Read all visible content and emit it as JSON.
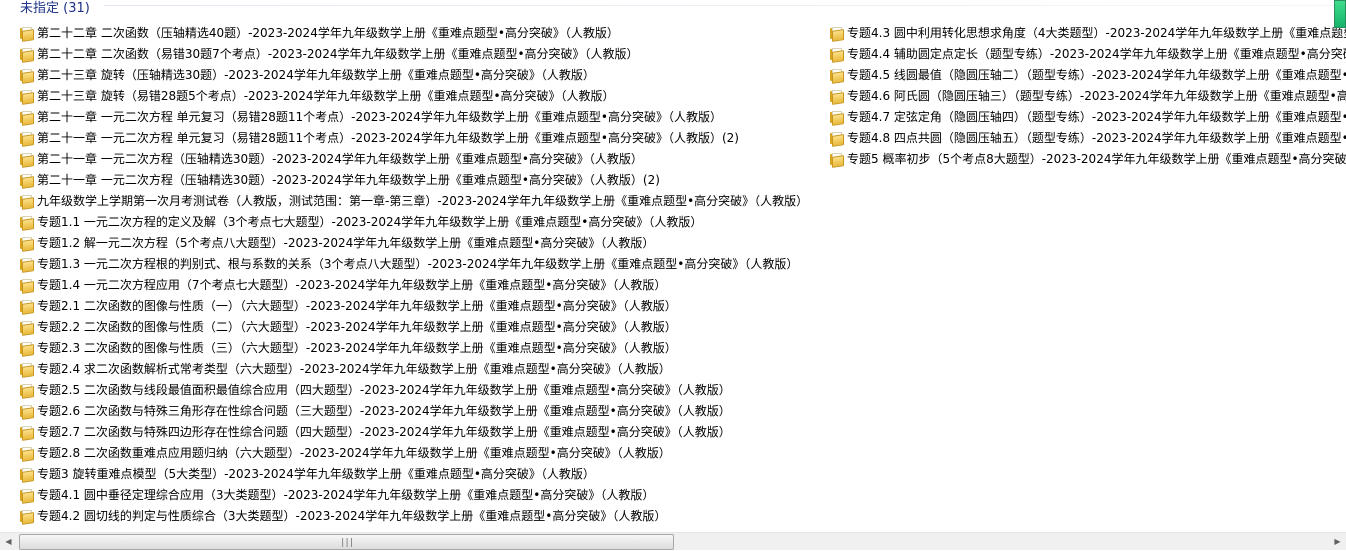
{
  "group": {
    "title": "未指定 (31)"
  },
  "left_items": [
    "第二十二章 二次函数（压轴精选40题）-2023-2024学年九年级数学上册《重难点题型•高分突破》（人教版）",
    "第二十二章 二次函数（易错30题7个考点）-2023-2024学年九年级数学上册《重难点题型•高分突破》（人教版）",
    "第二十三章 旋转（压轴精选30题）-2023-2024学年九年级数学上册《重难点题型•高分突破》（人教版）",
    "第二十三章 旋转（易错28题5个考点）-2023-2024学年九年级数学上册《重难点题型•高分突破》（人教版）",
    "第二十一章 一元二次方程 单元复习（易错28题11个考点）-2023-2024学年九年级数学上册《重难点题型•高分突破》（人教版）",
    "第二十一章 一元二次方程 单元复习（易错28题11个考点）-2023-2024学年九年级数学上册《重难点题型•高分突破》（人教版）(2)",
    "第二十一章 一元二次方程（压轴精选30题）-2023-2024学年九年级数学上册《重难点题型•高分突破》（人教版）",
    "第二十一章 一元二次方程（压轴精选30题）-2023-2024学年九年级数学上册《重难点题型•高分突破》（人教版）(2)",
    "九年级数学上学期第一次月考测试卷（人教版，测试范围：第一章-第三章）-2023-2024学年九年级数学上册《重难点题型•高分突破》（人教版）",
    "专题1.1 一元二次方程的定义及解（3个考点七大题型）-2023-2024学年九年级数学上册《重难点题型•高分突破》（人教版）",
    "专题1.2 解一元二次方程（5个考点八大题型）-2023-2024学年九年级数学上册《重难点题型•高分突破》（人教版）",
    "专题1.3 一元二次方程根的判别式、根与系数的关系（3个考点八大题型）-2023-2024学年九年级数学上册《重难点题型•高分突破》（人教版）",
    "专题1.4 一元二次方程应用（7个考点七大题型）-2023-2024学年九年级数学上册《重难点题型•高分突破》（人教版）",
    "专题2.1 二次函数的图像与性质（一）（六大题型）-2023-2024学年九年级数学上册《重难点题型•高分突破》（人教版）",
    "专题2.2 二次函数的图像与性质（二）（六大题型）-2023-2024学年九年级数学上册《重难点题型•高分突破》（人教版）",
    "专题2.3 二次函数的图像与性质（三）（六大题型）-2023-2024学年九年级数学上册《重难点题型•高分突破》（人教版）",
    "专题2.4 求二次函数解析式常考类型（六大题型）-2023-2024学年九年级数学上册《重难点题型•高分突破》（人教版）",
    "专题2.5 二次函数与线段最值面积最值综合应用（四大题型）-2023-2024学年九年级数学上册《重难点题型•高分突破》（人教版）",
    "专题2.6 二次函数与特殊三角形存在性综合问题（三大题型）-2023-2024学年九年级数学上册《重难点题型•高分突破》（人教版）",
    "专题2.7 二次函数与特殊四边形存在性综合问题（四大题型）-2023-2024学年九年级数学上册《重难点题型•高分突破》（人教版）",
    "专题2.8 二次函数重难点应用题归纳（六大题型）-2023-2024学年九年级数学上册《重难点题型•高分突破》（人教版）",
    "专题3 旋转重难点模型（5大类型）-2023-2024学年九年级数学上册《重难点题型•高分突破》（人教版）",
    "专题4.1 圆中垂径定理综合应用（3大类题型）-2023-2024学年九年级数学上册《重难点题型•高分突破》（人教版）",
    "专题4.2 圆切线的判定与性质综合（3大类题型）-2023-2024学年九年级数学上册《重难点题型•高分突破》（人教版）"
  ],
  "right_items": [
    "专题4.3 圆中利用转化思想求角度（4大类题型）-2023-2024学年九年级数学上册《重难点题型",
    "专题4.4 辅助圆定点定长（题型专练）-2023-2024学年九年级数学上册《重难点题型•高分突破",
    "专题4.5 线圆最值（隐圆压轴二）（题型专练）-2023-2024学年九年级数学上册《重难点题型•",
    "专题4.6 阿氏圆（隐圆压轴三）（题型专练）-2023-2024学年九年级数学上册《重难点题型•高",
    "专题4.7 定弦定角（隐圆压轴四）（题型专练）-2023-2024学年九年级数学上册《重难点题型•",
    "专题4.8 四点共圆（隐圆压轴五）（题型专练）-2023-2024学年九年级数学上册《重难点题型•",
    "专题5 概率初步（5个考点8大题型）-2023-2024学年九年级数学上册《重难点题型•高分突破》"
  ],
  "scrollbar": {
    "left_arrow": "◀",
    "right_arrow": "▶",
    "grip": "|||"
  },
  "icons": {
    "item_icon": "folder-icon"
  },
  "colors": {
    "group_title": "#1e3287",
    "folder": "#e9b93a"
  }
}
